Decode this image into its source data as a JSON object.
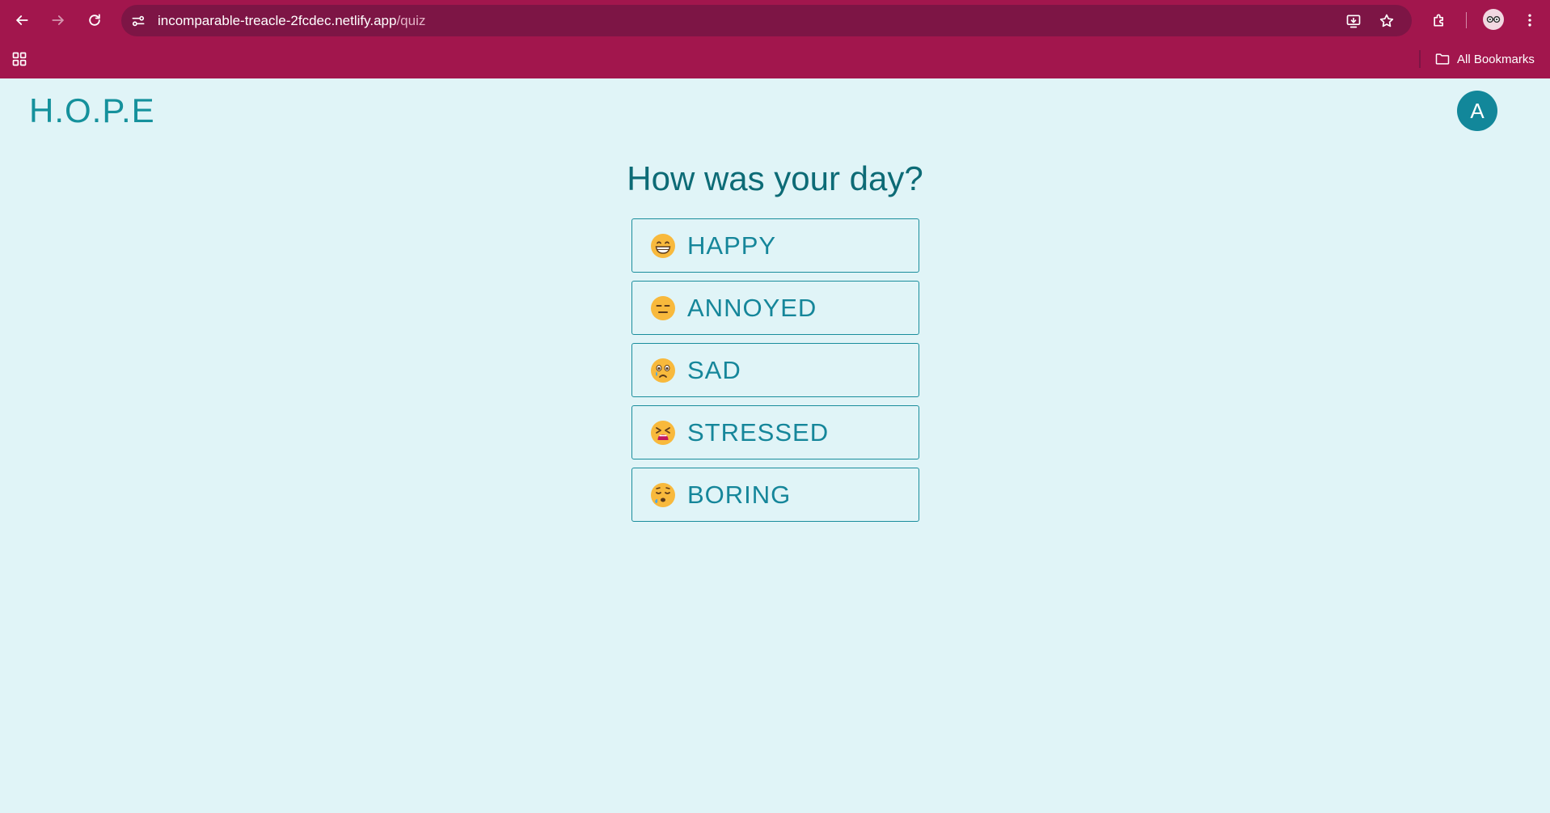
{
  "browser": {
    "url_host": "incomparable-treacle-2fcdec.netlify.app",
    "url_path": "/quiz",
    "bookmarks_label": "All Bookmarks"
  },
  "app": {
    "brand": "H.O.P.E",
    "avatar_initial": "A"
  },
  "quiz": {
    "question": "How was your day?",
    "options": [
      {
        "label": "HAPPY",
        "icon": "grinning-face-icon"
      },
      {
        "label": "ANNOYED",
        "icon": "expressionless-face-icon"
      },
      {
        "label": "SAD",
        "icon": "crying-face-icon"
      },
      {
        "label": "STRESSED",
        "icon": "tired-face-icon"
      },
      {
        "label": "BORING",
        "icon": "sleepy-face-icon"
      }
    ]
  },
  "colors": {
    "chrome": "#a2164d",
    "omnibox": "#7d1545",
    "page_bg": "#e0f4f7",
    "accent": "#15919c",
    "avatar": "#12879a"
  }
}
